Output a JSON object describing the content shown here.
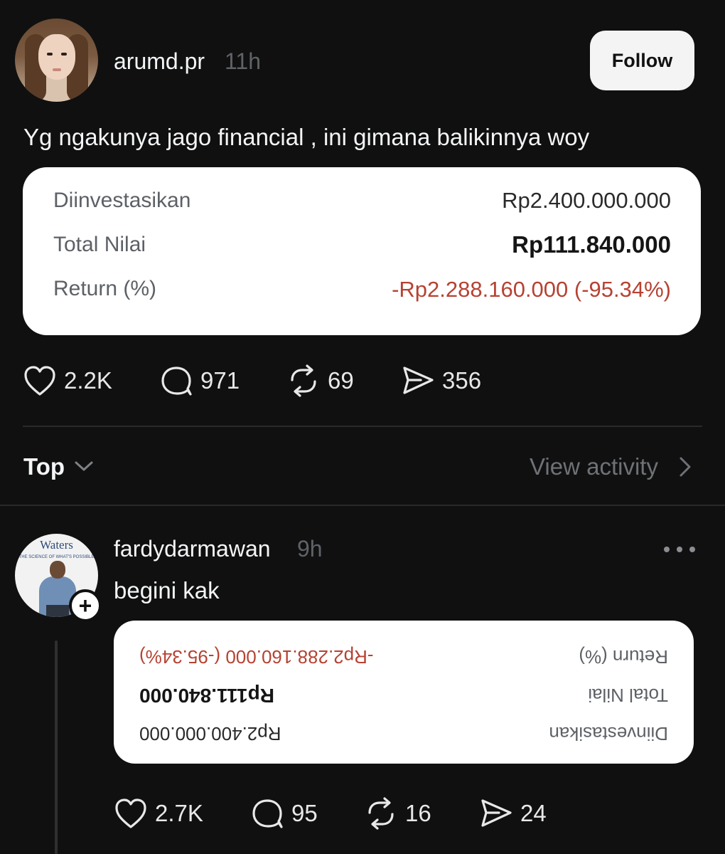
{
  "post": {
    "username": "arumd.pr",
    "time": "11h",
    "follow_label": "Follow",
    "text": "Yg ngakunya jago financial , ini gimana balikinnya woy",
    "card": {
      "rows": [
        {
          "label": "Diinvestasikan",
          "value": "Rp2.400.000.000"
        },
        {
          "label": "Total Nilai",
          "value": "Rp111.840.000"
        },
        {
          "label": "Return (%)",
          "value": "-Rp2.288.160.000 (-95.34%)"
        }
      ]
    },
    "stats": {
      "likes": "2.2K",
      "comments": "971",
      "reposts": "69",
      "shares": "356"
    }
  },
  "replies_header": {
    "sort_label": "Top",
    "activity_label": "View activity"
  },
  "reply": {
    "username": "fardydarmawan",
    "time": "9h",
    "avatar_brand": "Waters",
    "avatar_tagline": "THE SCIENCE OF WHAT'S POSSIBLE",
    "text": "begini kak",
    "card": {
      "rows": [
        {
          "label": "Diinvestasikan",
          "value": "Rp2.400.000.000"
        },
        {
          "label": "Total Nilai",
          "value": "Rp111.840.000"
        },
        {
          "label": "Return (%)",
          "value": "-Rp2.288.160.000 (-95.34%)"
        }
      ]
    },
    "stats": {
      "likes": "2.7K",
      "comments": "95",
      "reposts": "16",
      "shares": "24"
    }
  },
  "icons": [
    "heart-icon",
    "comment-icon",
    "repost-icon",
    "share-icon",
    "chevron-down-icon",
    "chevron-right-icon",
    "more-icon",
    "plus-icon"
  ],
  "colors": {
    "background": "#101010",
    "negative": "#b64232",
    "card": "#ffffff"
  }
}
